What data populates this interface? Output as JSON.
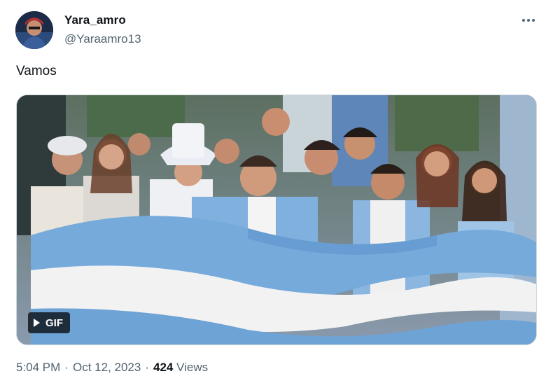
{
  "tweet": {
    "author": {
      "display_name": "Yara_amro",
      "handle": "@Yaraamro13"
    },
    "more_icon": "more-horizontal-icon",
    "text": "Vamos",
    "media": {
      "type_label": "GIF",
      "play_icon": "play-icon"
    },
    "meta": {
      "time": "5:04 PM",
      "separator": "·",
      "date": "Oct 12, 2023",
      "views_count": "424",
      "views_label": "Views"
    }
  },
  "colors": {
    "text_primary": "#0f1419",
    "text_secondary": "#536471",
    "border": "#cfd9de",
    "flag_blue": "#75aadb",
    "flag_white": "#f2f2f2"
  }
}
